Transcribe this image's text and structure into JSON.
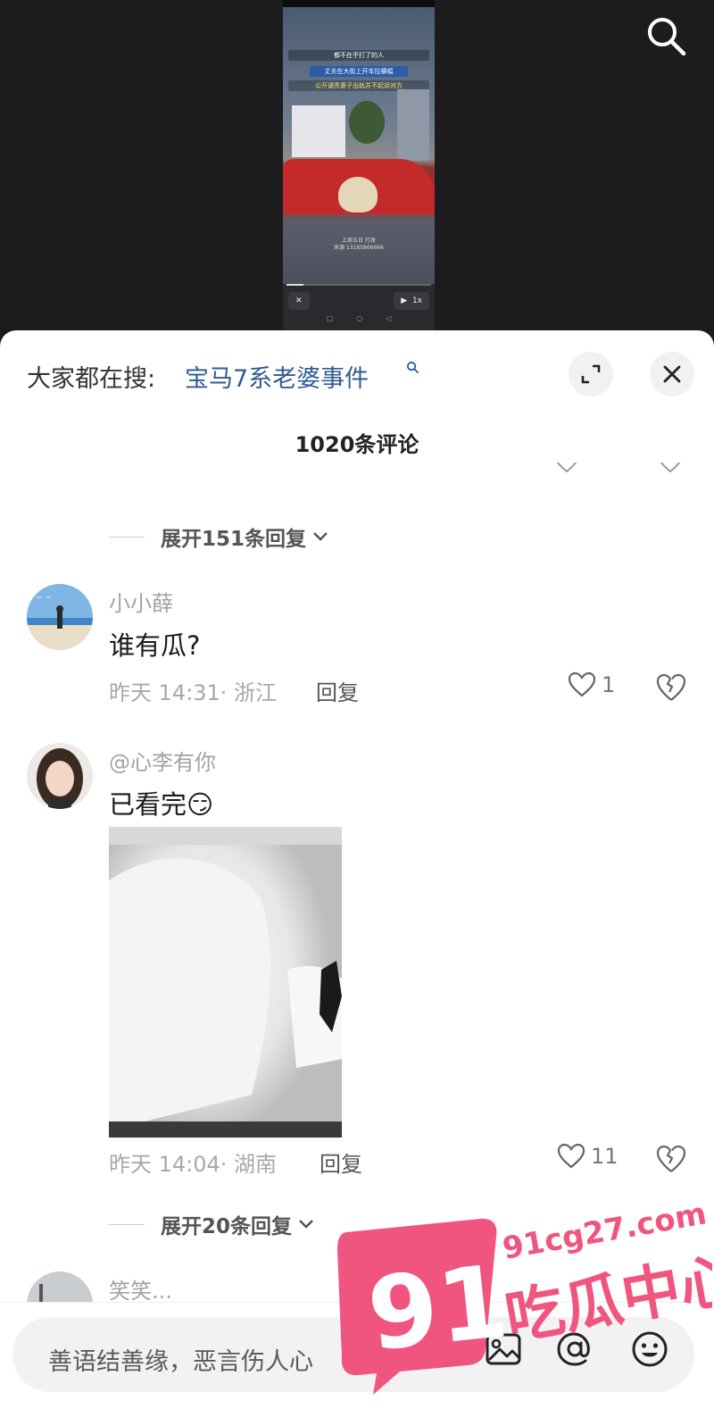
{
  "video": {
    "caption_line1": "都不在乎打了的人",
    "caption_line2": "丈夫在大街上开车拉横幅",
    "caption_line3": "公开谴责妻子出轨并不起诉对方",
    "footer_text": "上周五日 打发\n来源 13185866666",
    "control_close": "✕",
    "control_speed": "1x"
  },
  "header": {
    "trend_prefix": "大家都在搜:",
    "trend_link": "宝马7系老婆事件",
    "comment_count": "1020条评论"
  },
  "thread": {
    "expand_top": "展开151条回复",
    "expand_bottom": "展开20条回复"
  },
  "comments": [
    {
      "username": "小小薛",
      "text": "谁有瓜?",
      "meta": "昨天 14:31· 浙江",
      "reply": "回复",
      "likes": "1"
    },
    {
      "username": "@心李有你",
      "text": "已看完😏",
      "meta": "昨天 14:04· 湖南",
      "reply": "回复",
      "likes": "11"
    },
    {
      "username": "笑笑..."
    }
  ],
  "input": {
    "placeholder": "善语结善缘，恶言伤人心"
  },
  "watermark": {
    "number": "91",
    "domain": "91cg27.com",
    "name": "吃瓜中心"
  },
  "colors": {
    "link": "#2f5c93",
    "watermark_pink": "#f0557f",
    "sheet_bg": "#ffffff",
    "video_bg": "#1c1c1f"
  }
}
